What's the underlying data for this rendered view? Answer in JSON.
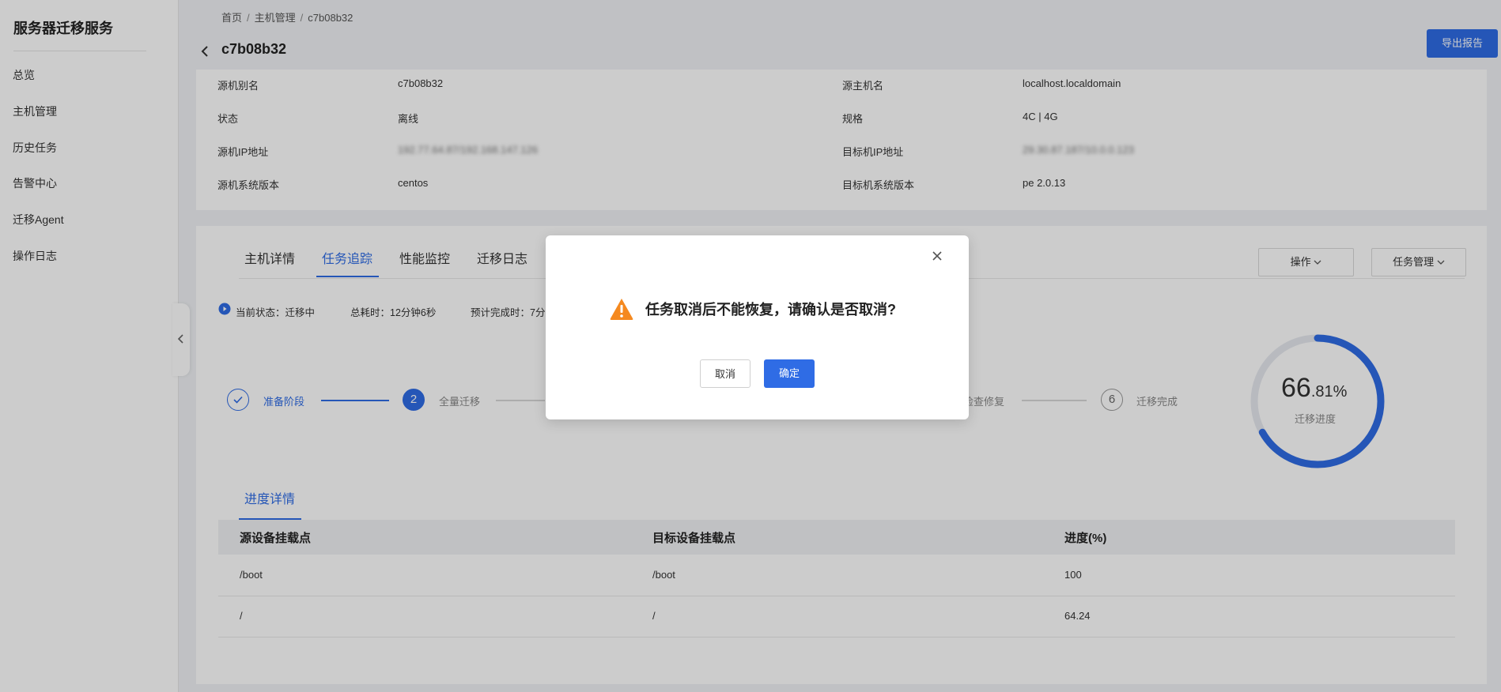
{
  "sidebar": {
    "title": "服务器迁移服务",
    "items": [
      {
        "label": "总览"
      },
      {
        "label": "主机管理"
      },
      {
        "label": "历史任务"
      },
      {
        "label": "告警中心"
      },
      {
        "label": "迁移Agent"
      },
      {
        "label": "操作日志"
      }
    ]
  },
  "breadcrumb": [
    "首页",
    "主机管理",
    "c7b08b32"
  ],
  "page_title": "c7b08b32",
  "export_button": "导出报告",
  "info": {
    "rows": [
      {
        "l1": "源机别名",
        "v1": "c7b08b32",
        "l2": "源主机名",
        "v2": "localhost.localdomain"
      },
      {
        "l1": "状态",
        "v1": "离线",
        "l2": "规格",
        "v2": "4C | 4G"
      },
      {
        "l1": "源机IP地址",
        "v1": "192.77.64.87/192.168.147.126",
        "l2": "目标机IP地址",
        "v2": "29.30.87.187/10.0.0.123"
      },
      {
        "l1": "源机系统版本",
        "v1": "centos",
        "l2": "目标机系统版本",
        "v2": "pe 2.0.13"
      }
    ]
  },
  "tabs": [
    "主机详情",
    "任务追踪",
    "性能监控",
    "迁移日志"
  ],
  "active_tab": "任务追踪",
  "dropdowns": {
    "operation": "操作",
    "task_manage": "任务管理"
  },
  "status": {
    "current": "当前状态：迁移中",
    "elapsed": "总耗时：12分钟6秒",
    "eta": "预计完成时：7分"
  },
  "steps": [
    {
      "num": "",
      "label": "准备阶段",
      "state": "done"
    },
    {
      "num": "2",
      "label": "全量迁移",
      "state": "active"
    },
    {
      "num": "",
      "label": "检查修复",
      "state": "pending"
    },
    {
      "num": "6",
      "label": "迁移完成",
      "state": "pending"
    }
  ],
  "progress": {
    "int": "66",
    "dec": ".81%",
    "label": "迁移进度",
    "value": 0.6681
  },
  "subtab": "进度详情",
  "table": {
    "headers": [
      "源设备挂载点",
      "目标设备挂载点",
      "进度(%)"
    ],
    "rows": [
      [
        "/boot",
        "/boot",
        "100"
      ],
      [
        "/",
        "/",
        "64.24"
      ]
    ]
  },
  "dialog": {
    "message": "任务取消后不能恢复，请确认是否取消?",
    "cancel": "取消",
    "confirm": "确定"
  },
  "colors": {
    "accent": "#2f6ce5",
    "warning": "#f5891f"
  }
}
